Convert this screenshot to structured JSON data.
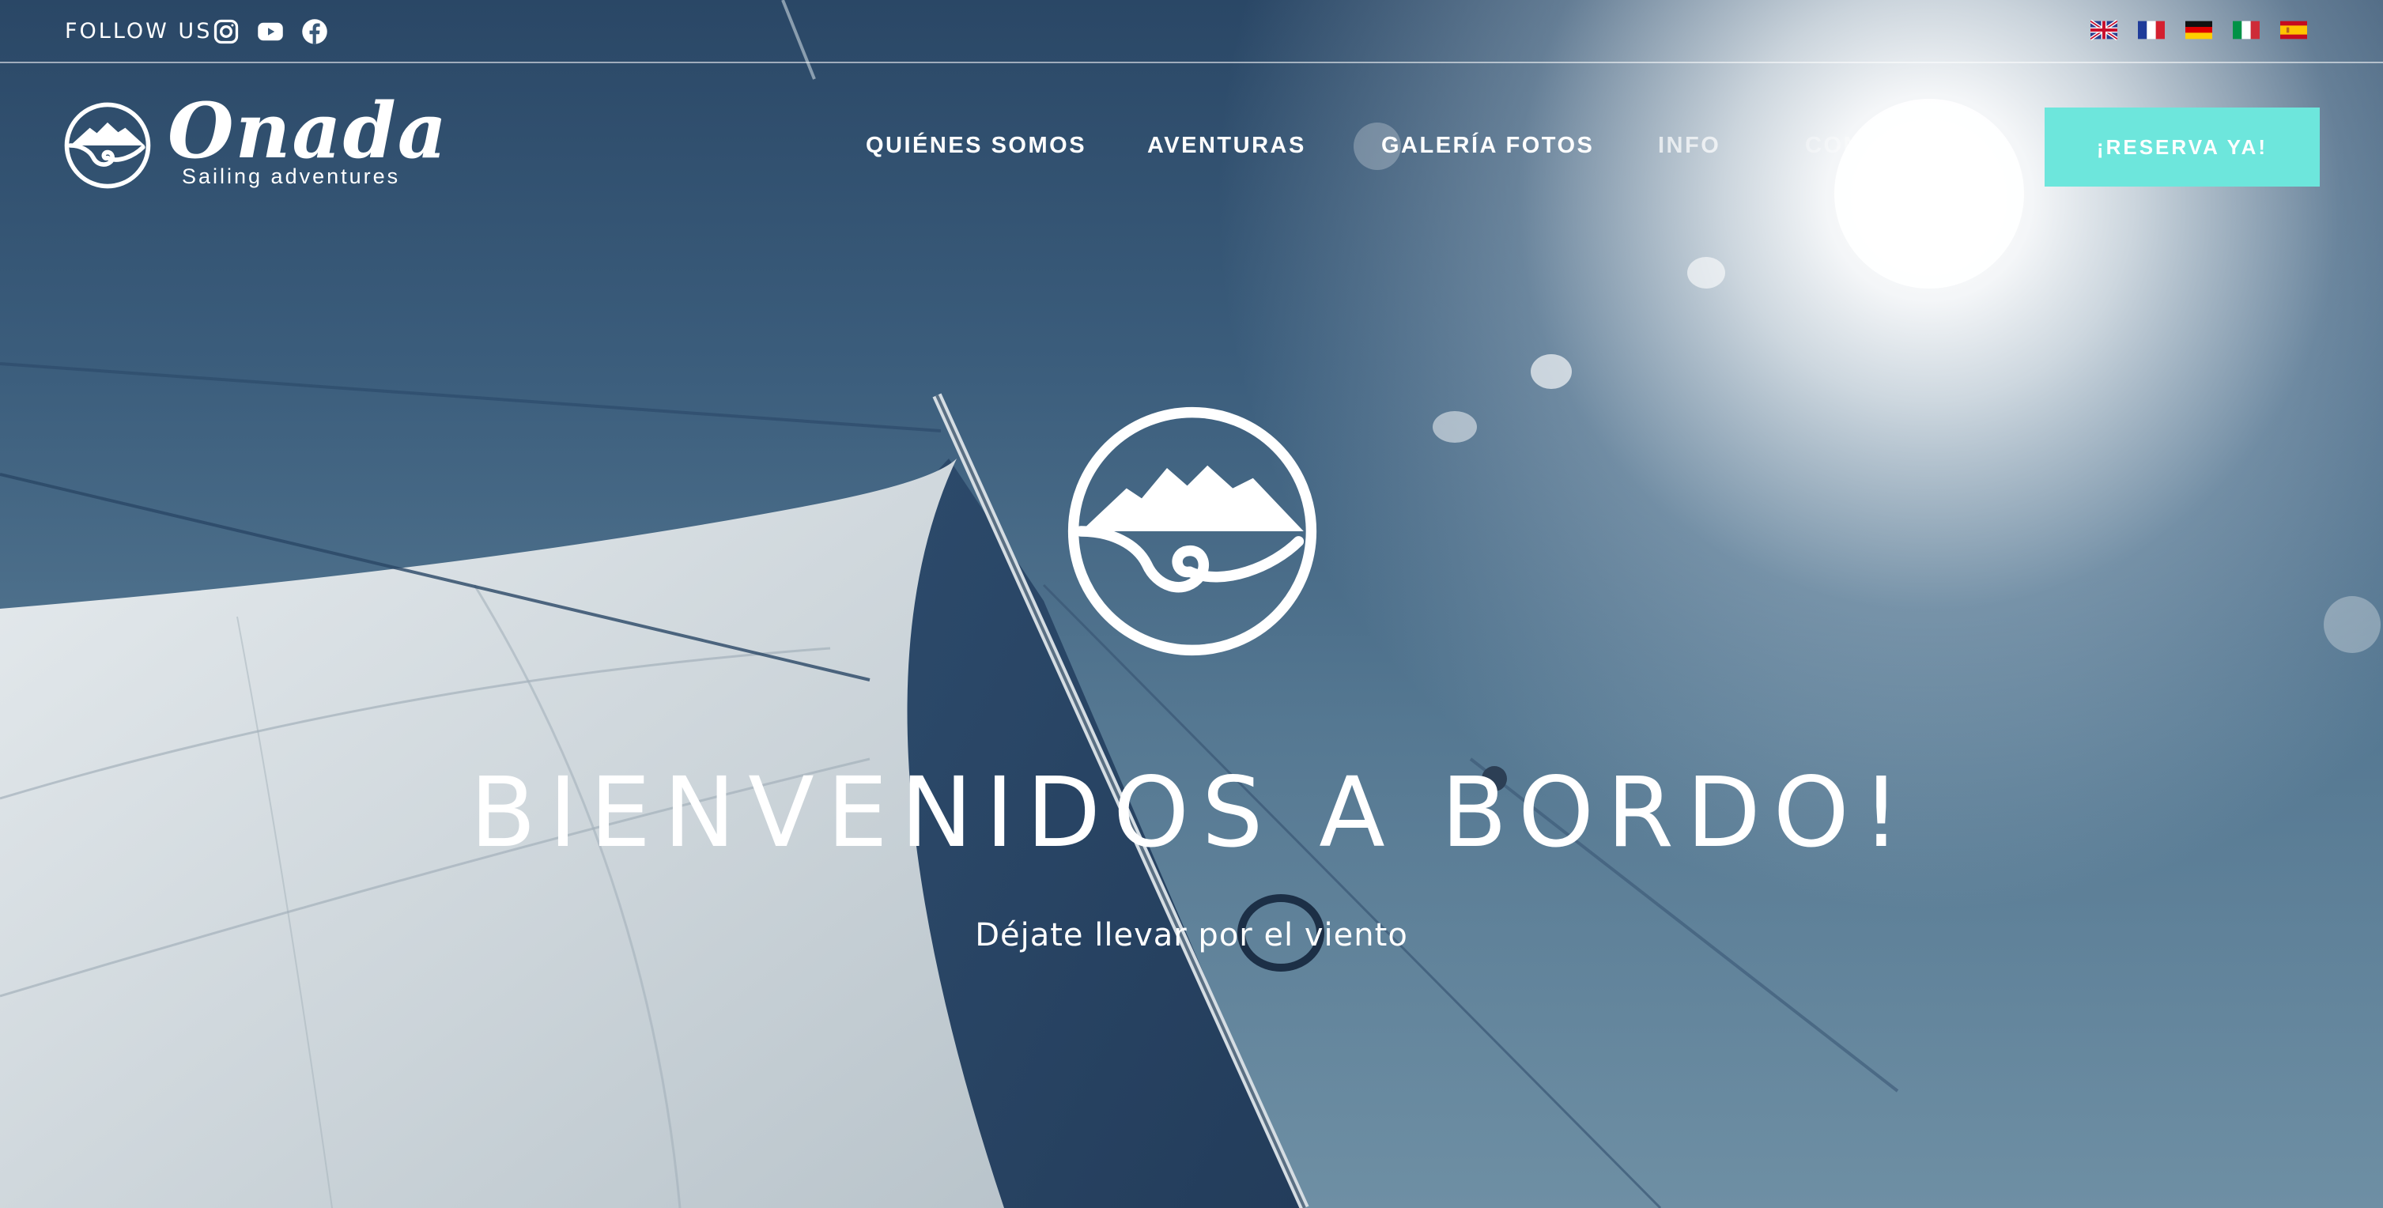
{
  "topbar": {
    "follow_label": "FOLLOW US",
    "social": [
      "instagram-icon",
      "youtube-icon",
      "facebook-icon"
    ],
    "languages": [
      "English",
      "Français",
      "Deutsch",
      "Italiano",
      "Español"
    ]
  },
  "brand": {
    "name": "Onada",
    "tagline": "Sailing adventures"
  },
  "nav": {
    "items": [
      {
        "label": "QUIÉNES SOMOS"
      },
      {
        "label": "AVENTURAS"
      },
      {
        "label": "GALERÍA FOTOS"
      },
      {
        "label": "INFO"
      },
      {
        "label": "CONTACTOS"
      }
    ],
    "cta_label": "¡RESERVA YA!"
  },
  "hero": {
    "title": "BIENVENIDOS A BORDO!",
    "subtitle": "Déjate llevar por el viento"
  },
  "colors": {
    "accent": "#6de6dc",
    "text": "#ffffff",
    "sky_dark": "#2a4766",
    "sky_light": "#6e8fa4"
  }
}
